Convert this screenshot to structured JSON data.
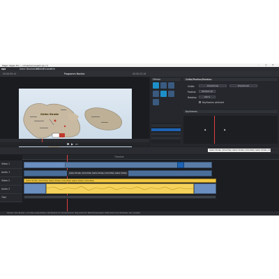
{
  "window": {
    "title": "Magix Vegas Pro — Unnamed project.vpr (*)",
    "min": "–",
    "max": "□",
    "close": "✕"
  },
  "menu": [
    "Datei",
    "Bearbeiten",
    "Effekte",
    "Fenster",
    "Hilfe"
  ],
  "brand": "vpx",
  "toolbar_tabs": [
    "Import",
    "Bildbaumer",
    "Export",
    "Audio",
    "Titel",
    "Effekte",
    "Vorschau"
  ],
  "top_right_buttons": {
    "primary": "Exportieren",
    "secondary": "Beenden"
  },
  "preview": {
    "timecode": "00:00:09:14",
    "title": "Programm Monitor",
    "duration": "00:00:23:16",
    "play_icon": "play-icon"
  },
  "map_label": "Gelbe Straße",
  "effects": {
    "header": "Effekte",
    "panel_title": "Größe/Position/Rotation",
    "fields": [
      {
        "label": "Größe",
        "value1": "Proportional",
        "value2": "Proportional"
      },
      {
        "label": "Position",
        "value1": "00:00:01:10",
        "value2": ""
      },
      {
        "label": "Rotation",
        "value1": "100 %",
        "value2": ""
      }
    ],
    "checkbox_label": "Keyframes aktiviert",
    "keyframes_label": "Keyframes"
  },
  "timeline": {
    "ruler_label": "Timeline",
    "tracks": [
      "Video 1",
      "Audio 1",
      "Video 2",
      "Audio 2",
      "Titel"
    ],
    "clip_label": "Gelbe Straße (Untertitel) Gelbe Straße (Untertitel) Gelbe Straße (Untertitel)",
    "track_audio_label": "Audio"
  },
  "status": "Klicken oder Ziehen, um Clips auszuwählen; Rechtsklick für Kontextmenü; Strg+Klick für Mehrfachauswahl; Shift+Klick zum Erweitern der Auswahl",
  "colors": {
    "accent": "#1d63b5",
    "clip_blue": "#6a8fc0",
    "clip_yellow": "#f0c640",
    "playhead": "#e04040"
  }
}
